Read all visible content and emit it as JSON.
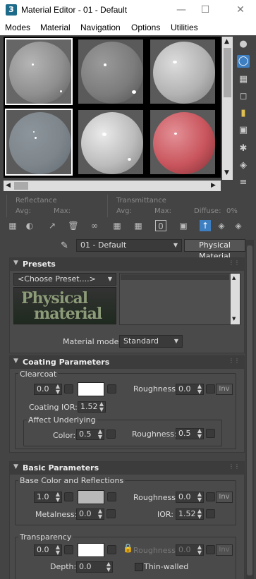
{
  "window": {
    "title": "Material Editor - 01 - Default",
    "icon": "3",
    "min_icon": "minimize-icon",
    "max_icon": "maximize-icon",
    "close_icon": "close-icon"
  },
  "menu": [
    "Modes",
    "Material",
    "Navigation",
    "Options",
    "Utilities"
  ],
  "reflectance": {
    "label": "Reflectance",
    "avg": "Avg:",
    "max": "Max:"
  },
  "transmittance": {
    "label": "Transmittance",
    "avg": "Avg:",
    "max": "Max:",
    "diffuse": "Diffuse:",
    "diffuse_value": "0%"
  },
  "material_name": "01 - Default",
  "material_type": "Physical Material",
  "presets": {
    "title": "Presets",
    "choose": "<Choose Preset....>",
    "logo_text_1": "Physical",
    "logo_text_2": "material",
    "mode_label": "Material mode:",
    "mode_value": "Standard"
  },
  "coating": {
    "title": "Coating Parameters",
    "clearcoat_label": "Clearcoat",
    "weight": "0.0",
    "roughness_label": "Roughness:",
    "roughness": "0.0",
    "inv": "Inv",
    "ior_label": "Coating IOR:",
    "ior": "1.52",
    "affect_label": "Affect Underlying",
    "color_label": "Color:",
    "color_value": "0.5",
    "aff_roughness_label": "Roughness:",
    "aff_roughness": "0.5",
    "swatch_color": "#ffffff"
  },
  "basic": {
    "title": "Basic Parameters",
    "base_label": "Base Color and Reflections",
    "weight": "1.0",
    "roughness_label": "Roughness:",
    "roughness": "0.0",
    "inv": "Inv",
    "metalness_label": "Metalness:",
    "metalness": "0.0",
    "ior_label": "IOR:",
    "ior": "1.52",
    "transparency_label": "Transparency",
    "trans_weight": "0.0",
    "trans_roughness_label": "Roughness:",
    "trans_roughness": "0.0",
    "trans_inv": "Inv",
    "depth_label": "Depth:",
    "depth": "0.0",
    "thin_walled_label": "Thin-walled",
    "base_color": "#b9b9b9",
    "trans_color": "#ffffff"
  },
  "slots": [
    {
      "color": "#8f8f8f"
    },
    {
      "color": "#7c7c7c"
    },
    {
      "color": "#b3b3b3"
    },
    {
      "color": "#7e868c"
    },
    {
      "color": "#bcbcbc"
    },
    {
      "color": "#c9555d"
    }
  ]
}
